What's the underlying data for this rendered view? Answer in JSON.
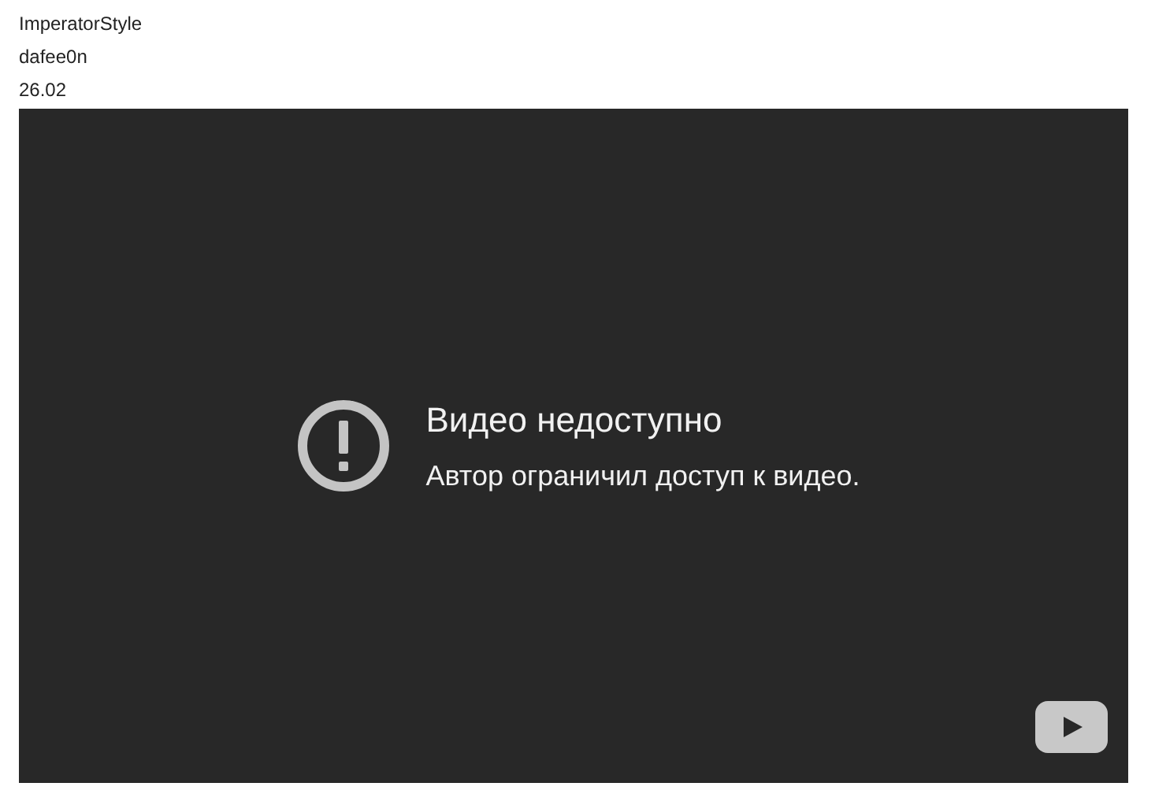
{
  "lines": [
    "ImperatorStyle",
    "dafee0n",
    "26.02"
  ],
  "video": {
    "title": "Видео недоступно",
    "message": "Автор ограничил доступ к видео."
  }
}
